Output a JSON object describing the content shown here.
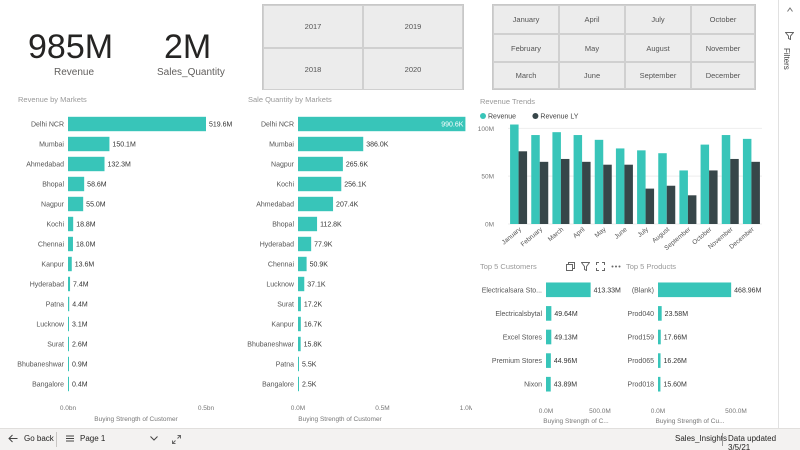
{
  "kpis": [
    {
      "value": "985M",
      "label": "Revenue"
    },
    {
      "value": "2M",
      "label": "Sales_Quantity"
    }
  ],
  "year_slicer": [
    "2017",
    "2019",
    "2018",
    "2020"
  ],
  "month_slicer": [
    "January",
    "April",
    "July",
    "October",
    "February",
    "May",
    "August",
    "November",
    "March",
    "June",
    "September",
    "December"
  ],
  "filters_label": "Filters",
  "chart_data": [
    {
      "type": "bar",
      "orientation": "horizontal",
      "title": "Revenue by Markets",
      "xlabel": "Buying Strength of Customer",
      "categories": [
        "Delhi NCR",
        "Mumbai",
        "Ahmedabad",
        "Bhopal",
        "Nagpur",
        "Kochi",
        "Chennai",
        "Kanpur",
        "Hyderabad",
        "Patna",
        "Lucknow",
        "Surat",
        "Bhubaneshwar",
        "Bangalore"
      ],
      "values": [
        519.6,
        150.1,
        132.3,
        58.6,
        55.0,
        18.8,
        18.0,
        13.6,
        7.4,
        4.4,
        3.1,
        2.6,
        0.9,
        0.4
      ],
      "labels": [
        "519.6M",
        "150.1M",
        "132.3M",
        "58.6M",
        "55.0M",
        "18.8M",
        "18.0M",
        "13.6M",
        "7.4M",
        "4.4M",
        "3.1M",
        "2.6M",
        "0.9M",
        "0.4M"
      ],
      "xticks": [
        "0.0bn",
        "0.5bn"
      ],
      "xlim": [
        0,
        500
      ],
      "color": "#38c5b9"
    },
    {
      "type": "bar",
      "orientation": "horizontal",
      "title": "Sale Quantity by Markets",
      "xlabel": "Buying Strength of Customer",
      "categories": [
        "Delhi NCR",
        "Mumbai",
        "Nagpur",
        "Kochi",
        "Ahmedabad",
        "Bhopal",
        "Hyderabad",
        "Chennai",
        "Lucknow",
        "Surat",
        "Kanpur",
        "Bhubaneshwar",
        "Patna",
        "Bangalore"
      ],
      "values": [
        990.6,
        386.0,
        265.6,
        256.1,
        207.4,
        112.8,
        77.9,
        50.9,
        37.1,
        17.2,
        16.7,
        15.8,
        5.5,
        2.5
      ],
      "labels": [
        "990.6K",
        "386.0K",
        "265.6K",
        "256.1K",
        "207.4K",
        "112.8K",
        "77.9K",
        "50.9K",
        "37.1K",
        "17.2K",
        "16.7K",
        "15.8K",
        "5.5K",
        "2.5K"
      ],
      "xticks": [
        "0.0M",
        "0.5M",
        "1.0M"
      ],
      "xlim": [
        0,
        1000
      ],
      "color": "#38c5b9"
    },
    {
      "type": "bar",
      "title": "Revenue Trends",
      "categories": [
        "January",
        "February",
        "March",
        "April",
        "May",
        "June",
        "July",
        "August",
        "September",
        "October",
        "November",
        "December"
      ],
      "series": [
        {
          "name": "Revenue",
          "values": [
            104,
            93,
            96,
            93,
            88,
            79,
            77,
            74,
            56,
            83,
            93,
            89
          ],
          "color": "#38c5b9"
        },
        {
          "name": "Revenue LY",
          "values": [
            76,
            65,
            68,
            65,
            62,
            62,
            37,
            40,
            30,
            56,
            68,
            65
          ],
          "color": "#374649"
        }
      ],
      "yticks": [
        "100M",
        "50M",
        "0M"
      ],
      "ylim": [
        0,
        115
      ],
      "legend": "top-left"
    },
    {
      "type": "bar",
      "orientation": "horizontal",
      "title": "Top 5 Customers",
      "xlabel": "Buying Strength of C...",
      "categories": [
        "Electricalsara Sto...",
        "Electricalsbytal",
        "Excel Stores",
        "Premium Stores",
        "Nixon"
      ],
      "values": [
        413.33,
        49.64,
        49.13,
        44.96,
        43.89
      ],
      "labels": [
        "413.33M",
        "49.64M",
        "49.13M",
        "44.96M",
        "43.89M"
      ],
      "xticks": [
        "0.0M",
        "500.0M"
      ],
      "xlim": [
        0,
        500
      ],
      "color": "#38c5b9"
    },
    {
      "type": "bar",
      "orientation": "horizontal",
      "title": "Top 5 Products",
      "xlabel": "Buying Strength of Cu...",
      "categories": [
        "(Blank)",
        "Prod040",
        "Prod159",
        "Prod065",
        "Prod018"
      ],
      "values": [
        468.96,
        23.58,
        17.66,
        16.26,
        15.6
      ],
      "labels": [
        "468.96M",
        "23.58M",
        "17.66M",
        "16.26M",
        "15.60M"
      ],
      "xticks": [
        "0.0M",
        "500.0M"
      ],
      "xlim": [
        0,
        500
      ],
      "color": "#38c5b9"
    }
  ],
  "visual_header_icons": [
    "copy-icon",
    "filter-icon",
    "focus-mode-icon",
    "more-options-icon"
  ],
  "bottom_bar": {
    "go_back": "Go back",
    "page": "Page 1",
    "report_name": "Sales_Insights",
    "updated": "Data updated 3/5/21"
  }
}
